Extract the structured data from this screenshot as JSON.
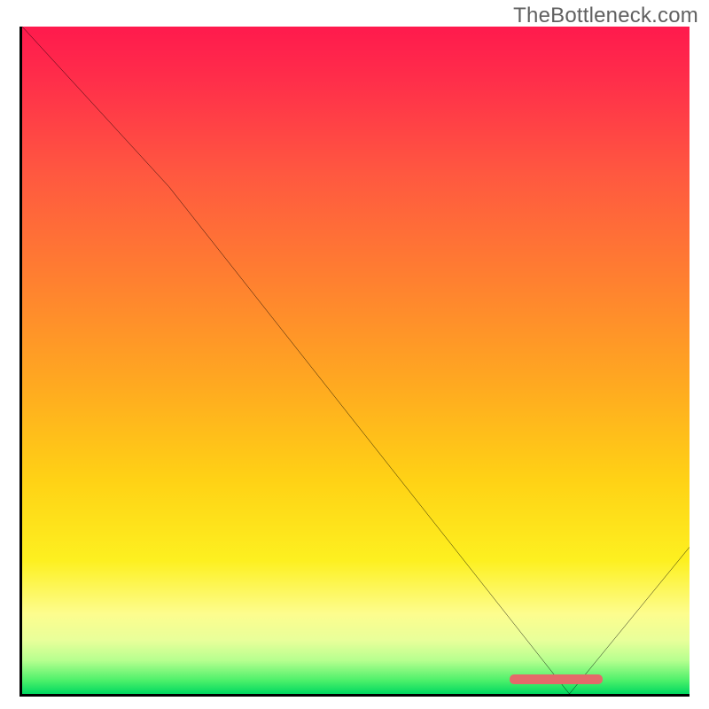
{
  "watermark": "TheBottleneck.com",
  "chart_data": {
    "type": "line",
    "title": "",
    "xlabel": "",
    "ylabel": "",
    "xlim": [
      0,
      100
    ],
    "ylim": [
      0,
      100
    ],
    "x": [
      0,
      22,
      82,
      100
    ],
    "values": [
      100,
      76,
      0,
      22
    ],
    "marker": {
      "x_start": 73,
      "x_end": 87,
      "y": 1.5
    },
    "gradient_stops": [
      {
        "pct": 0,
        "color": "#ff1a4d"
      },
      {
        "pct": 8,
        "color": "#ff2e4a"
      },
      {
        "pct": 22,
        "color": "#ff5840"
      },
      {
        "pct": 38,
        "color": "#ff8030"
      },
      {
        "pct": 54,
        "color": "#ffaa20"
      },
      {
        "pct": 68,
        "color": "#ffd215"
      },
      {
        "pct": 80,
        "color": "#fdf020"
      },
      {
        "pct": 88,
        "color": "#fdfd8e"
      },
      {
        "pct": 92,
        "color": "#e8ff9a"
      },
      {
        "pct": 95,
        "color": "#b6ff8f"
      },
      {
        "pct": 98,
        "color": "#4cf06a"
      },
      {
        "pct": 100,
        "color": "#00d860"
      }
    ]
  }
}
